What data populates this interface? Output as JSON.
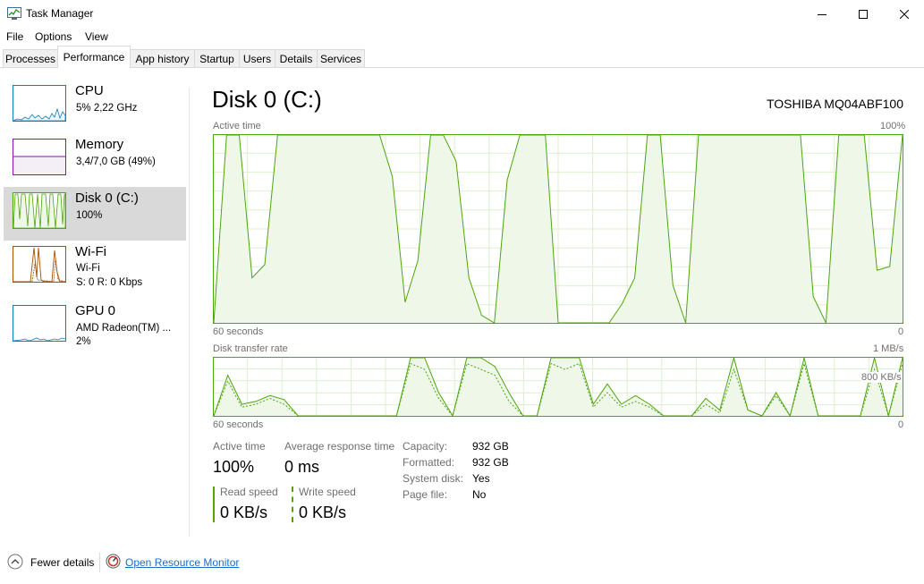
{
  "window": {
    "title": "Task Manager",
    "icon": "task-manager-icon"
  },
  "menu": [
    "File",
    "Options",
    "View"
  ],
  "tabs": [
    {
      "label": "Processes"
    },
    {
      "label": "Performance"
    },
    {
      "label": "App history"
    },
    {
      "label": "Startup"
    },
    {
      "label": "Users"
    },
    {
      "label": "Details"
    },
    {
      "label": "Services"
    }
  ],
  "active_tab": "Performance",
  "sidebar": {
    "items": [
      {
        "title": "CPU",
        "line1": "5%  2,22 GHz",
        "line2": ""
      },
      {
        "title": "Memory",
        "line1": "3,4/7,0 GB (49%)",
        "line2": ""
      },
      {
        "title": "Disk 0 (C:)",
        "line1": "100%",
        "line2": ""
      },
      {
        "title": "Wi-Fi",
        "line1": "Wi-Fi",
        "line2": "S: 0  R: 0 Kbps"
      },
      {
        "title": "GPU 0",
        "line1": "AMD Radeon(TM) ...",
        "line2": "2%"
      }
    ],
    "selected": "Disk 0 (C:)"
  },
  "main": {
    "title": "Disk 0 (C:)",
    "model": "TOSHIBA MQ04ABF100",
    "active_graph": {
      "label": "Active time",
      "max_label": "100%",
      "time_label": "60 seconds",
      "min_label": "0"
    },
    "transfer_graph": {
      "label": "Disk transfer rate",
      "max_label": "1 MB/s",
      "mid_label": "800 KB/s",
      "time_label": "60 seconds",
      "min_label": "0"
    },
    "stats": {
      "active_time": {
        "label": "Active time",
        "value": "100%"
      },
      "avg_response": {
        "label": "Average response time",
        "value": "0 ms"
      },
      "read_speed": {
        "label": "Read speed",
        "value": "0 KB/s"
      },
      "write_speed": {
        "label": "Write speed",
        "value": "0 KB/s"
      }
    },
    "props": [
      {
        "label": "Capacity:",
        "value": "932 GB"
      },
      {
        "label": "Formatted:",
        "value": "932 GB"
      },
      {
        "label": "System disk:",
        "value": "Yes"
      },
      {
        "label": "Page file:",
        "value": "No"
      }
    ]
  },
  "footer": {
    "fewer_details": "Fewer details",
    "resource_monitor": "Open Resource Monitor"
  },
  "colors": {
    "disk_green": "#4da60c",
    "disk_fill": "#eff7e9",
    "grid": "#dcefcf",
    "cpu_blue": "#117dbb",
    "mem_purple": "#8b12ae",
    "wifi_orange": "#a74f01",
    "gpu_blue": "#117dbb"
  },
  "series": {
    "active_time_percent": [
      0,
      100,
      100,
      24,
      31,
      100,
      100,
      100,
      100,
      100,
      100,
      100,
      100,
      100,
      78,
      11,
      33,
      100,
      100,
      86,
      24,
      4,
      0,
      76,
      100,
      100,
      100,
      0,
      0,
      0,
      0,
      0,
      10,
      24,
      100,
      100,
      20,
      0,
      100,
      100,
      100,
      100,
      100,
      100,
      100,
      100,
      100,
      14,
      0,
      100,
      100,
      100,
      28,
      30,
      100
    ],
    "transfer_read_percent": [
      0,
      70,
      20,
      25,
      35,
      28,
      0,
      0,
      0,
      0,
      0,
      0,
      0,
      0,
      100,
      100,
      40,
      0,
      100,
      100,
      85,
      40,
      0,
      0,
      100,
      100,
      100,
      20,
      55,
      20,
      35,
      20,
      0,
      0,
      0,
      30,
      10,
      100,
      10,
      0,
      40,
      0,
      100,
      0,
      0,
      0,
      0,
      100,
      0,
      100
    ],
    "transfer_write_percent": [
      0,
      60,
      15,
      20,
      30,
      20,
      0,
      0,
      0,
      0,
      0,
      0,
      0,
      0,
      90,
      80,
      30,
      0,
      90,
      80,
      70,
      25,
      0,
      0,
      90,
      80,
      90,
      15,
      40,
      15,
      25,
      15,
      0,
      0,
      0,
      20,
      5,
      80,
      10,
      0,
      35,
      0,
      90,
      0,
      0,
      0,
      0,
      80,
      0,
      90
    ]
  }
}
